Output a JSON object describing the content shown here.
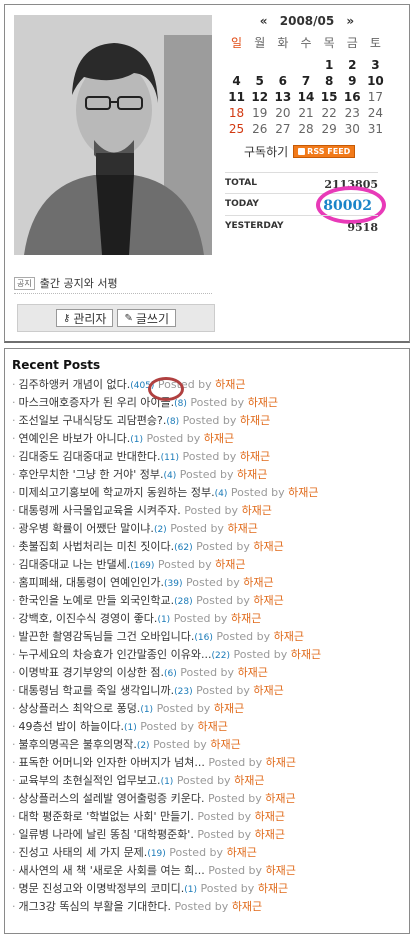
{
  "calendar": {
    "prev": "«",
    "title": "2008/05",
    "next": "»",
    "weekdays": [
      "일",
      "월",
      "화",
      "수",
      "목",
      "금",
      "토"
    ],
    "weeks": [
      [
        "",
        "",
        "",
        "",
        "1",
        "2",
        "3"
      ],
      [
        "4",
        "5",
        "6",
        "7",
        "8",
        "9",
        "10"
      ],
      [
        "11",
        "12",
        "13",
        "14",
        "15",
        "16",
        "17"
      ],
      [
        "18",
        "19",
        "20",
        "21",
        "22",
        "23",
        "24"
      ],
      [
        "25",
        "26",
        "27",
        "28",
        "29",
        "30",
        "31"
      ]
    ]
  },
  "subscribe": {
    "label": "구독하기",
    "rss": "RSS FEED"
  },
  "stats": {
    "total_label": "TOTAL",
    "total": "2113805",
    "today_label": "TODAY",
    "today": "80002",
    "yesterday_label": "YESTERDAY",
    "yesterday": "9518"
  },
  "notice": {
    "tag": "공지",
    "text": "출간 공지와 서평"
  },
  "buttons": {
    "admin": "관리자",
    "write": "글쓰기"
  },
  "recent": {
    "title": "Recent Posts",
    "by": "Posted by",
    "author": "하재근",
    "items": [
      {
        "t": "김주하앵커 개념이 없다.",
        "c": "(405)"
      },
      {
        "t": "마스크애호증자가 된 우리 아이들.",
        "c": "(8)"
      },
      {
        "t": "조선일보 구내식당도 괴담편승?.",
        "c": "(8)"
      },
      {
        "t": "연예인은 바보가 아니다.",
        "c": "(1)"
      },
      {
        "t": "김대중도 김대중대교 반대한다.",
        "c": "(11)"
      },
      {
        "t": "후안무치한 '그냥 한 거야' 정부.",
        "c": "(4)"
      },
      {
        "t": "미제쇠고기홍보에 학교까지 동원하는 정부.",
        "c": "(4)"
      },
      {
        "t": "대통령께 사극몰입교육을 시켜주자.",
        "c": ""
      },
      {
        "t": "광우병 확률이 어쨌단 말이냐.",
        "c": "(2)"
      },
      {
        "t": "촛불집회 사법처리는 미친 짓이다.",
        "c": "(62)"
      },
      {
        "t": "김대중대교 나는 반댈세.",
        "c": "(169)"
      },
      {
        "t": "홈피폐쇄, 대통령이 연예인인가.",
        "c": "(39)"
      },
      {
        "t": "한국인을 노예로 만들 외국인학교.",
        "c": "(28)"
      },
      {
        "t": "강백호, 이진수식 경영이 좋다.",
        "c": "(1)"
      },
      {
        "t": "발끈한 촬영감독님들 그건 오바입니다.",
        "c": "(16)"
      },
      {
        "t": "누구세요의 차승효가 인간말종인 이유와...",
        "c": "(22)"
      },
      {
        "t": "이명박표 경기부양의 이상한 점.",
        "c": "(6)"
      },
      {
        "t": "대통령님 학교를 죽일 생각입니까.",
        "c": "(23)"
      },
      {
        "t": "상상플러스 최악으로 퐁덩.",
        "c": "(1)"
      },
      {
        "t": "49층선 밥이 하늘이다.",
        "c": "(1)"
      },
      {
        "t": "불후의명곡은 불후의명작.",
        "c": "(2)"
      },
      {
        "t": "표독한 어머니와 인자한 아버지가 넘쳐...",
        "c": ""
      },
      {
        "t": "교육부의 초현실적인 업무보고.",
        "c": "(1)"
      },
      {
        "t": "상상플러스의 설레발 영어출렁증 키운다.",
        "c": ""
      },
      {
        "t": "대학 평준화로 '학벌없는 사회' 만들기.",
        "c": ""
      },
      {
        "t": "일류병 나라에 날린 똥침 '대학평준화'.",
        "c": ""
      },
      {
        "t": "진성고 사태의 세 가지 문제.",
        "c": "(19)"
      },
      {
        "t": "새사연의 새 책 '새로운 사회를 여는 희...",
        "c": ""
      },
      {
        "t": "명문 진성고와 이명박정부의 코미디.",
        "c": "(1)"
      },
      {
        "t": "개그3강 똑심의 부활을 기대한다.",
        "c": ""
      }
    ]
  }
}
